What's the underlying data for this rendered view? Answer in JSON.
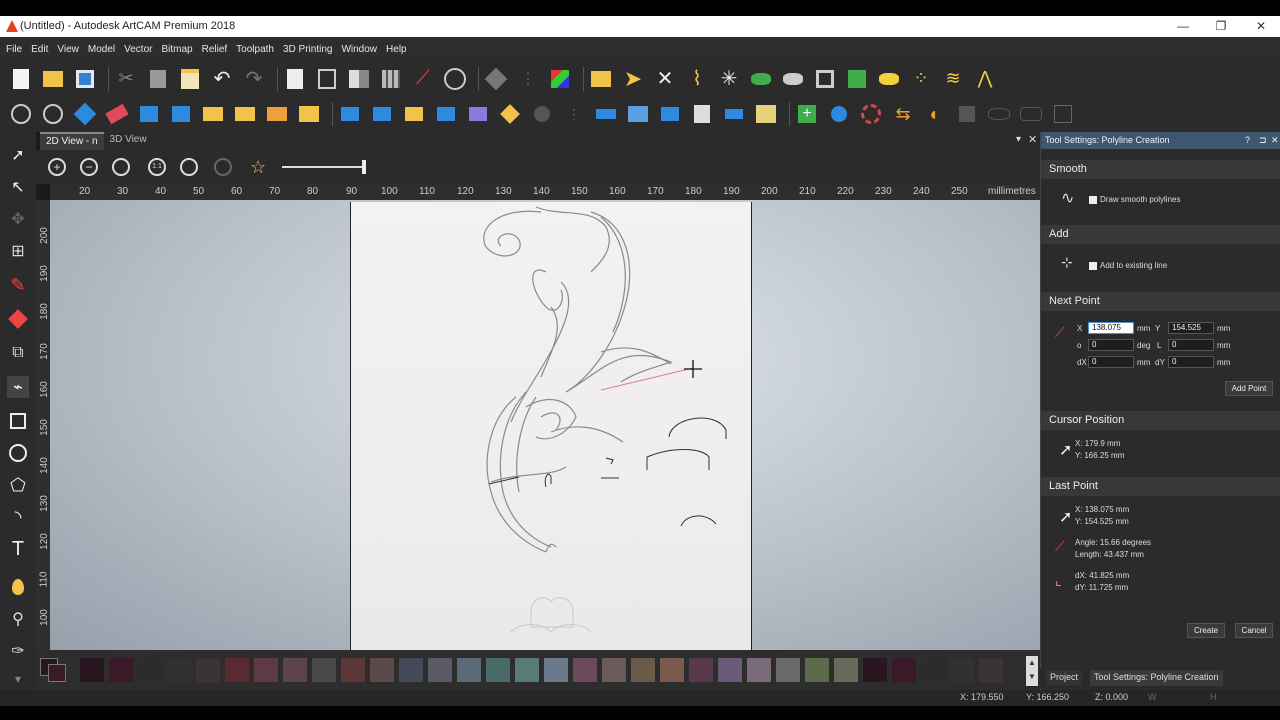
{
  "window": {
    "title": "(Untitled) - Autodesk ArtCAM Premium 2018"
  },
  "menu": [
    "File",
    "Edit",
    "View",
    "Model",
    "Vector",
    "Bitmap",
    "Relief",
    "Toolpath",
    "3D Printing",
    "Window",
    "Help"
  ],
  "tabs": {
    "view2d": "2D View - n",
    "view3d": "3D View"
  },
  "ruler": {
    "units": "millimetres",
    "x_ticks": [
      "20",
      "30",
      "40",
      "50",
      "60",
      "70",
      "80",
      "90",
      "100",
      "110",
      "120",
      "130",
      "140",
      "150",
      "160",
      "170",
      "180",
      "190",
      "200",
      "210",
      "220",
      "230",
      "240",
      "250"
    ],
    "y_ticks": [
      "200",
      "190",
      "180",
      "170",
      "160",
      "150",
      "140",
      "130",
      "120",
      "110",
      "100"
    ]
  },
  "panel": {
    "title": "Tool Settings: Polyline Creation",
    "title_icons": [
      "?",
      "⊐",
      "✕"
    ],
    "smooth": {
      "header": "Smooth",
      "checkbox_label": "Draw smooth polylines"
    },
    "add": {
      "header": "Add",
      "checkbox_label": "Add to existing line"
    },
    "next_point": {
      "header": "Next Point",
      "x_label": "X",
      "x_value": "138.075",
      "x_unit": "mm",
      "y_label": "Y",
      "y_value": "154.525",
      "y_unit": "mm",
      "o_label": "o",
      "o_value": "0",
      "o_unit": "deg",
      "l_label": "L",
      "l_value": "0",
      "l_unit": "mm",
      "dx_label": "dX",
      "dx_value": "0",
      "dx_unit": "mm",
      "dy_label": "dY",
      "dy_value": "0",
      "dy_unit": "mm",
      "add_button": "Add Point"
    },
    "cursor": {
      "header": "Cursor Position",
      "x": "X: 179.9   mm",
      "y": "Y: 166.25 mm"
    },
    "last_point": {
      "header": "Last Point",
      "x": "X: 138.075 mm",
      "y": "Y: 154.525 mm",
      "angle": "Angle:  15.66  degrees",
      "length": "Length: 43.437 mm",
      "dx": "dX: 41.825 mm",
      "dy": "dY: 11.725 mm"
    },
    "create_button": "Create",
    "cancel_button": "Cancel"
  },
  "bottom_tabs": {
    "project": "Project",
    "tool_settings": "Tool Settings: Polyline Creation"
  },
  "status": {
    "x": "X: 179.550",
    "y": "Y: 166.250",
    "z": "Z: 0.000",
    "w": "W",
    "h": "H"
  },
  "palette_colors": [
    "#2a1620",
    "#3a1a28",
    "#2c2c2c",
    "#333030",
    "#3a3338",
    "#5a2a32",
    "#5e3a44",
    "#5b444a",
    "#4a4a4a",
    "#5a3838",
    "#5c4a4a",
    "#444a5a",
    "#5a5a66",
    "#5a6a78",
    "#4a6a6a",
    "#5a7a78",
    "#6a7a8a",
    "#6a4a5a",
    "#6a5a5a",
    "#6a5a4a",
    "#7a5a4a",
    "#5a3a4a",
    "#6a5a7a",
    "#7a6a7a",
    "#6a6a6a",
    "#5a6a4a",
    "#6a6a5a"
  ],
  "accent": {
    "panel_title": "#3f5670",
    "app_icon": "#e2431f"
  }
}
